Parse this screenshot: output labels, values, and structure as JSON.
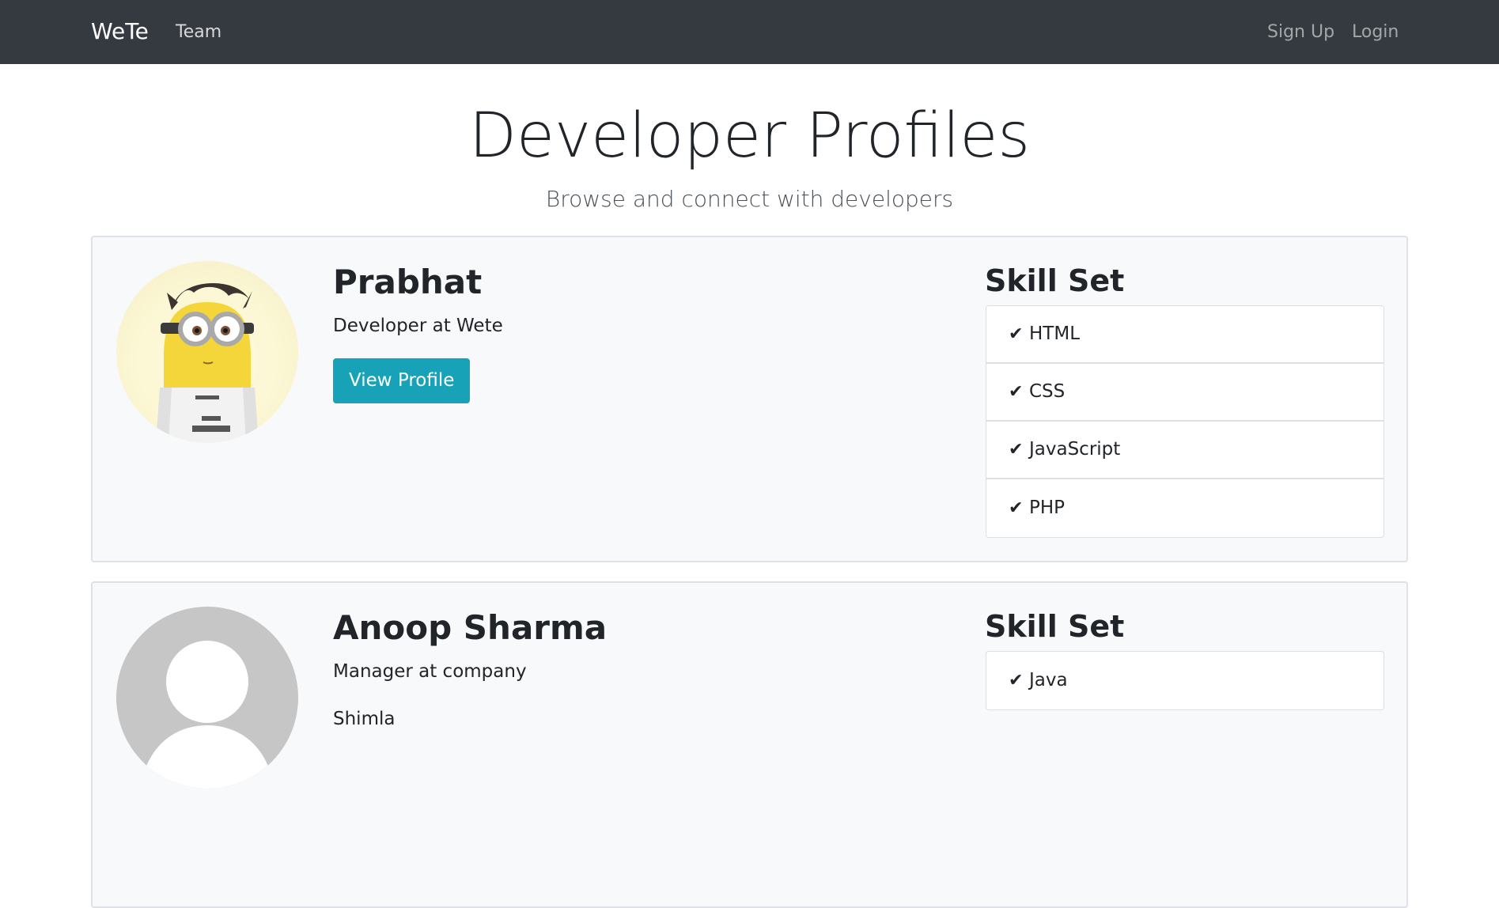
{
  "navbar": {
    "brand": "WeTe",
    "links": {
      "team": "Team",
      "signup": "Sign Up",
      "login": "Login"
    },
    "background": "#343a40"
  },
  "header": {
    "title": "Developer Profiles",
    "subtitle": "Browse and connect with developers"
  },
  "profiles": [
    {
      "name": "Prabhat",
      "role": "Developer at Wete",
      "button_label": "View Profile",
      "skill_heading": "Skill Set",
      "skills": [
        "HTML",
        "CSS",
        "JavaScript",
        "PHP"
      ],
      "check_icon": "check-icon"
    },
    {
      "name": "Anoop Sharma",
      "role": "Manager at company",
      "location": "Shimla",
      "skill_heading": "Skill Set",
      "skills": [
        "Java"
      ],
      "check_icon": "check-icon"
    }
  ],
  "colors": {
    "accent_button": "#17a2b8",
    "card_background": "#f8f9fa"
  }
}
